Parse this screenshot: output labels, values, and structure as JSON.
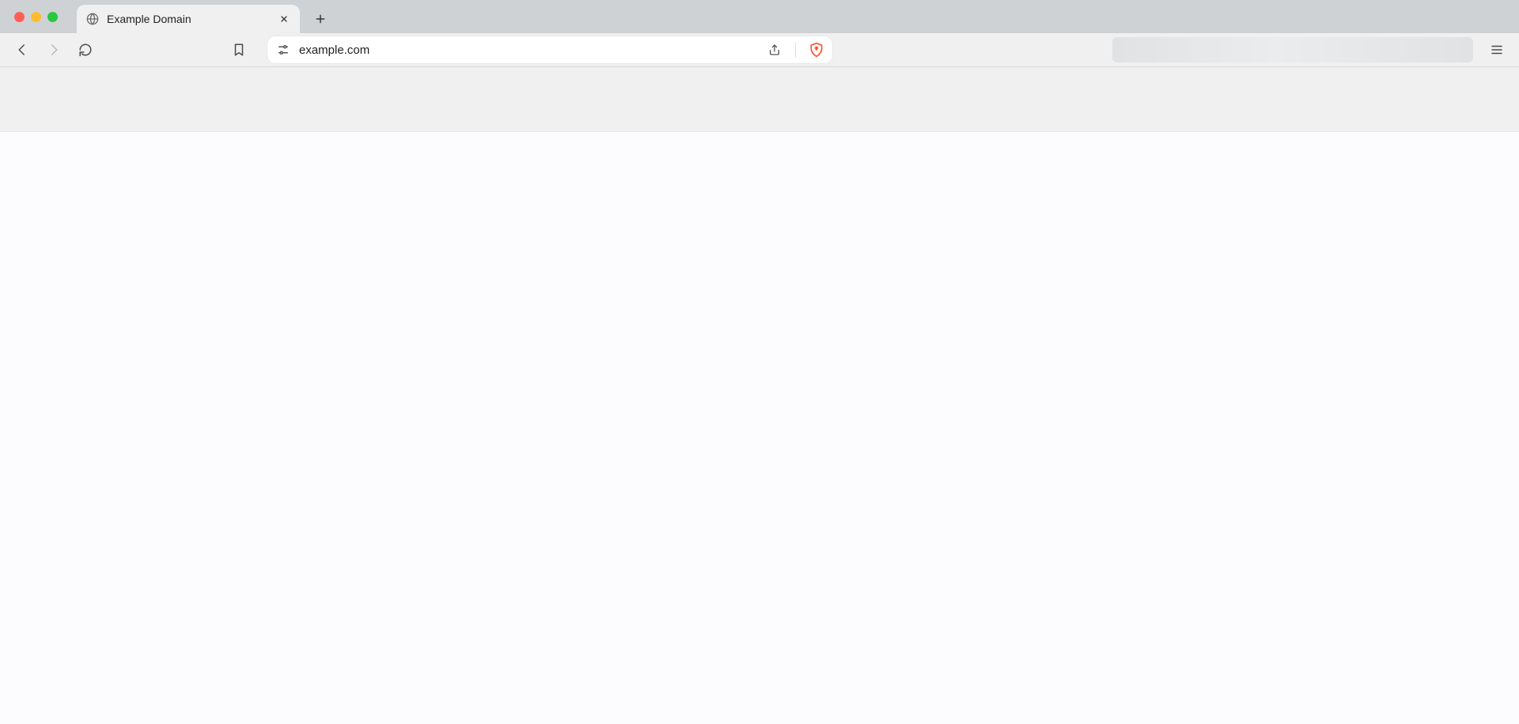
{
  "tab": {
    "title": "Example Domain"
  },
  "address_bar": {
    "url": "example.com"
  },
  "colors": {
    "brave_orange": "#fb542b"
  }
}
